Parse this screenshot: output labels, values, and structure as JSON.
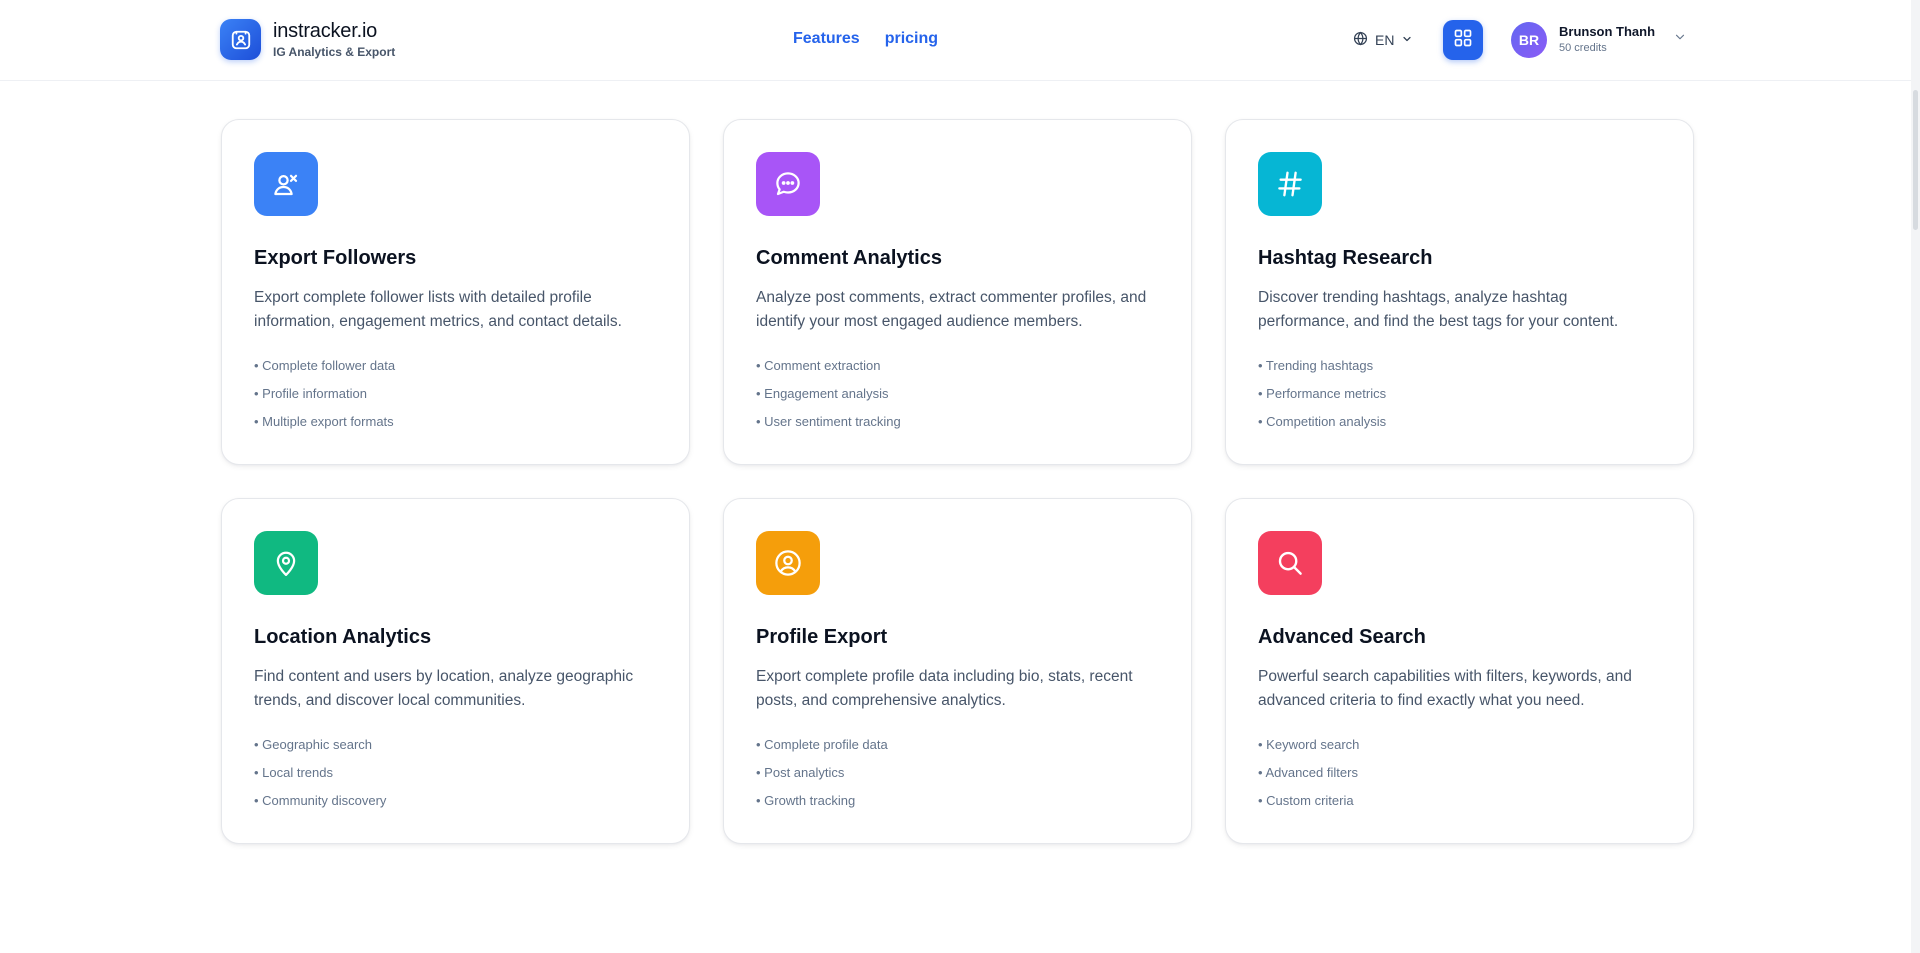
{
  "brand": {
    "name": "instracker.io",
    "subtitle": "IG Analytics & Export",
    "logo_icon": "user-scan-icon"
  },
  "nav": {
    "features": "Features",
    "pricing": "pricing"
  },
  "language": {
    "value": "EN",
    "icon": "globe-icon"
  },
  "user": {
    "initials": "BR",
    "name": "Brunson Thanh",
    "credits": "50 credits"
  },
  "colors": {
    "accent": "#2563eb",
    "blue": "#3b82f6",
    "purple": "#a855f7",
    "cyan": "#06b6d4",
    "green": "#10b981",
    "amber": "#f59e0b",
    "rose": "#f43f5e"
  },
  "features": [
    {
      "title": "Export Followers",
      "description": "Export complete follower lists with detailed profile information, engagement metrics, and contact details.",
      "bullets": [
        "• Complete follower data",
        "• Profile information",
        "• Multiple export formats"
      ],
      "icon": "users-icon",
      "color": "#3b82f6"
    },
    {
      "title": "Comment Analytics",
      "description": "Analyze post comments, extract commenter profiles, and identify your most engaged audience members.",
      "bullets": [
        "• Comment extraction",
        "• Engagement analysis",
        "• User sentiment tracking"
      ],
      "icon": "chat-bubble-icon",
      "color": "#a855f7"
    },
    {
      "title": "Hashtag Research",
      "description": "Discover trending hashtags, analyze hashtag performance, and find the best tags for your content.",
      "bullets": [
        "• Trending hashtags",
        "• Performance metrics",
        "• Competition analysis"
      ],
      "icon": "hashtag-icon",
      "color": "#06b6d4"
    },
    {
      "title": "Location Analytics",
      "description": "Find content and users by location, analyze geographic trends, and discover local communities.",
      "bullets": [
        "• Geographic search",
        "• Local trends",
        "• Community discovery"
      ],
      "icon": "map-pin-icon",
      "color": "#10b981"
    },
    {
      "title": "Profile Export",
      "description": "Export complete profile data including bio, stats, recent posts, and comprehensive analytics.",
      "bullets": [
        "• Complete profile data",
        "• Post analytics",
        "• Growth tracking"
      ],
      "icon": "user-circle-icon",
      "color": "#f59e0b"
    },
    {
      "title": "Advanced Search",
      "description": "Powerful search capabilities with filters, keywords, and advanced criteria to find exactly what you need.",
      "bullets": [
        "• Keyword search",
        "• Advanced filters",
        "• Custom criteria"
      ],
      "icon": "search-icon",
      "color": "#f43f5e"
    }
  ]
}
